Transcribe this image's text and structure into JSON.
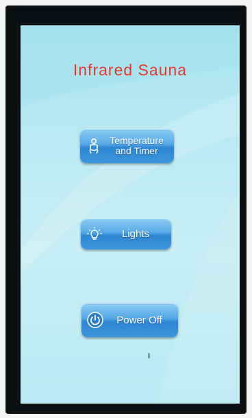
{
  "screen": {
    "title": "Infrared Sauna",
    "title_color": "#e6372f"
  },
  "buttons": {
    "temperature_timer": {
      "line1": "Temperature",
      "line2": "and Timer",
      "icon": "person-sitting-icon"
    },
    "lights": {
      "label": "Lights",
      "icon": "light-bulb-icon"
    },
    "power_off": {
      "label": "Power Off",
      "icon": "power-icon"
    }
  },
  "colors": {
    "button_top": "#8ecdf4",
    "button_bottom": "#2f86d1",
    "screen_background": "#bdeaf2",
    "bezel": "#0b1013"
  }
}
